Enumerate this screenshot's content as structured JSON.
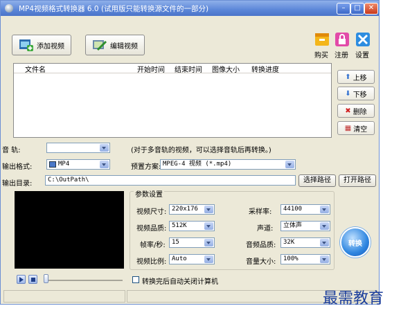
{
  "window": {
    "title": "MP4视频格式转换器 6.0 (试用版只能转换源文件的一部分)",
    "min_label": "–",
    "max_label": "□",
    "close_label": "✕"
  },
  "toolbar": {
    "add_video": "添加视频",
    "edit_video": "编辑视频",
    "buy": "购买",
    "register": "注册",
    "settings": "设置"
  },
  "file_list": {
    "columns": [
      "文件名",
      "开始时间",
      "结束时间",
      "图像大小",
      "转换进度"
    ]
  },
  "side_buttons": {
    "up": "上移",
    "down": "下移",
    "delete": "删除",
    "clear": "清空"
  },
  "audio_track": {
    "label": "音    轨:",
    "value": "",
    "hint": "(对于多音轨的视频，可以选择音轨后再转换。)"
  },
  "output_format": {
    "label": "输出格式:",
    "value": "MP4"
  },
  "preset": {
    "label": "预置方案:",
    "value": "MPEG-4 视频 (*.mp4)"
  },
  "output_dir": {
    "label": "输出目录:",
    "value": "C:\\OutPath\\",
    "choose": "选择路径",
    "open": "打开路径"
  },
  "params": {
    "title": "参数设置",
    "video_size": {
      "label": "视频尺寸:",
      "value": "220x176"
    },
    "video_quality": {
      "label": "视频品质:",
      "value": "512K"
    },
    "frame_rate": {
      "label": "帧率/秒:",
      "value": "15"
    },
    "aspect": {
      "label": "视频比例:",
      "value": "Auto"
    },
    "sample_rate": {
      "label": "采样率:",
      "value": "44100"
    },
    "channel": {
      "label": "声道:",
      "value": "立体声"
    },
    "audio_quality": {
      "label": "音频品质:",
      "value": "32K"
    },
    "volume": {
      "label": "音量大小:",
      "value": "100%"
    }
  },
  "convert_button": "转换",
  "shutdown_option": {
    "label": "转换完后自动关闭计算机",
    "checked": false
  },
  "watermark": "最需教育"
}
